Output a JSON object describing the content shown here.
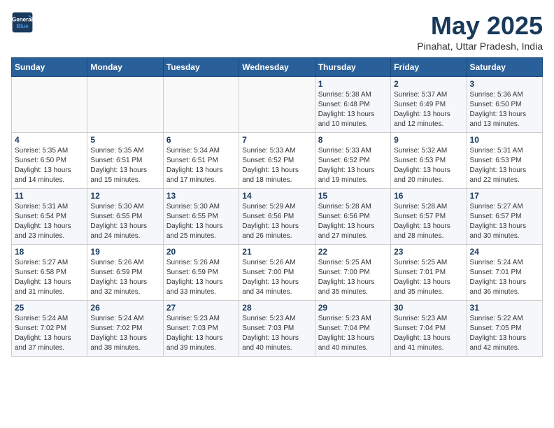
{
  "logo": {
    "line1": "General",
    "line2": "Blue"
  },
  "title": "May 2025",
  "location": "Pinahat, Uttar Pradesh, India",
  "days_of_week": [
    "Sunday",
    "Monday",
    "Tuesday",
    "Wednesday",
    "Thursday",
    "Friday",
    "Saturday"
  ],
  "weeks": [
    [
      {
        "day": "",
        "info": ""
      },
      {
        "day": "",
        "info": ""
      },
      {
        "day": "",
        "info": ""
      },
      {
        "day": "",
        "info": ""
      },
      {
        "day": "1",
        "info": "Sunrise: 5:38 AM\nSunset: 6:48 PM\nDaylight: 13 hours\nand 10 minutes."
      },
      {
        "day": "2",
        "info": "Sunrise: 5:37 AM\nSunset: 6:49 PM\nDaylight: 13 hours\nand 12 minutes."
      },
      {
        "day": "3",
        "info": "Sunrise: 5:36 AM\nSunset: 6:50 PM\nDaylight: 13 hours\nand 13 minutes."
      }
    ],
    [
      {
        "day": "4",
        "info": "Sunrise: 5:35 AM\nSunset: 6:50 PM\nDaylight: 13 hours\nand 14 minutes."
      },
      {
        "day": "5",
        "info": "Sunrise: 5:35 AM\nSunset: 6:51 PM\nDaylight: 13 hours\nand 15 minutes."
      },
      {
        "day": "6",
        "info": "Sunrise: 5:34 AM\nSunset: 6:51 PM\nDaylight: 13 hours\nand 17 minutes."
      },
      {
        "day": "7",
        "info": "Sunrise: 5:33 AM\nSunset: 6:52 PM\nDaylight: 13 hours\nand 18 minutes."
      },
      {
        "day": "8",
        "info": "Sunrise: 5:33 AM\nSunset: 6:52 PM\nDaylight: 13 hours\nand 19 minutes."
      },
      {
        "day": "9",
        "info": "Sunrise: 5:32 AM\nSunset: 6:53 PM\nDaylight: 13 hours\nand 20 minutes."
      },
      {
        "day": "10",
        "info": "Sunrise: 5:31 AM\nSunset: 6:53 PM\nDaylight: 13 hours\nand 22 minutes."
      }
    ],
    [
      {
        "day": "11",
        "info": "Sunrise: 5:31 AM\nSunset: 6:54 PM\nDaylight: 13 hours\nand 23 minutes."
      },
      {
        "day": "12",
        "info": "Sunrise: 5:30 AM\nSunset: 6:55 PM\nDaylight: 13 hours\nand 24 minutes."
      },
      {
        "day": "13",
        "info": "Sunrise: 5:30 AM\nSunset: 6:55 PM\nDaylight: 13 hours\nand 25 minutes."
      },
      {
        "day": "14",
        "info": "Sunrise: 5:29 AM\nSunset: 6:56 PM\nDaylight: 13 hours\nand 26 minutes."
      },
      {
        "day": "15",
        "info": "Sunrise: 5:28 AM\nSunset: 6:56 PM\nDaylight: 13 hours\nand 27 minutes."
      },
      {
        "day": "16",
        "info": "Sunrise: 5:28 AM\nSunset: 6:57 PM\nDaylight: 13 hours\nand 28 minutes."
      },
      {
        "day": "17",
        "info": "Sunrise: 5:27 AM\nSunset: 6:57 PM\nDaylight: 13 hours\nand 30 minutes."
      }
    ],
    [
      {
        "day": "18",
        "info": "Sunrise: 5:27 AM\nSunset: 6:58 PM\nDaylight: 13 hours\nand 31 minutes."
      },
      {
        "day": "19",
        "info": "Sunrise: 5:26 AM\nSunset: 6:59 PM\nDaylight: 13 hours\nand 32 minutes."
      },
      {
        "day": "20",
        "info": "Sunrise: 5:26 AM\nSunset: 6:59 PM\nDaylight: 13 hours\nand 33 minutes."
      },
      {
        "day": "21",
        "info": "Sunrise: 5:26 AM\nSunset: 7:00 PM\nDaylight: 13 hours\nand 34 minutes."
      },
      {
        "day": "22",
        "info": "Sunrise: 5:25 AM\nSunset: 7:00 PM\nDaylight: 13 hours\nand 35 minutes."
      },
      {
        "day": "23",
        "info": "Sunrise: 5:25 AM\nSunset: 7:01 PM\nDaylight: 13 hours\nand 35 minutes."
      },
      {
        "day": "24",
        "info": "Sunrise: 5:24 AM\nSunset: 7:01 PM\nDaylight: 13 hours\nand 36 minutes."
      }
    ],
    [
      {
        "day": "25",
        "info": "Sunrise: 5:24 AM\nSunset: 7:02 PM\nDaylight: 13 hours\nand 37 minutes."
      },
      {
        "day": "26",
        "info": "Sunrise: 5:24 AM\nSunset: 7:02 PM\nDaylight: 13 hours\nand 38 minutes."
      },
      {
        "day": "27",
        "info": "Sunrise: 5:23 AM\nSunset: 7:03 PM\nDaylight: 13 hours\nand 39 minutes."
      },
      {
        "day": "28",
        "info": "Sunrise: 5:23 AM\nSunset: 7:03 PM\nDaylight: 13 hours\nand 40 minutes."
      },
      {
        "day": "29",
        "info": "Sunrise: 5:23 AM\nSunset: 7:04 PM\nDaylight: 13 hours\nand 40 minutes."
      },
      {
        "day": "30",
        "info": "Sunrise: 5:23 AM\nSunset: 7:04 PM\nDaylight: 13 hours\nand 41 minutes."
      },
      {
        "day": "31",
        "info": "Sunrise: 5:22 AM\nSunset: 7:05 PM\nDaylight: 13 hours\nand 42 minutes."
      }
    ]
  ]
}
